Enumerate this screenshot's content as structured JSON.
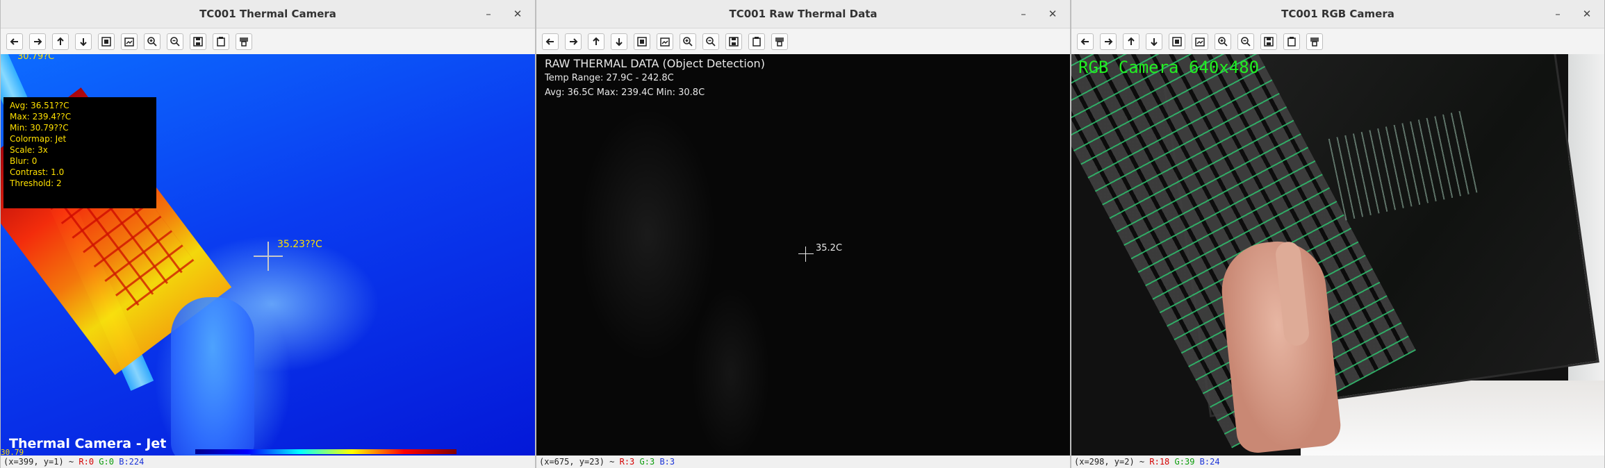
{
  "windows": [
    {
      "title": "TC001 Thermal Camera",
      "status": {
        "coords": "(x=399, y=1) ~ ",
        "r": "R:0",
        "g": "G:0",
        "b": "B:224"
      }
    },
    {
      "title": "TC001 Raw Thermal Data",
      "status": {
        "coords": "(x=675, y=23) ~ ",
        "r": "R:3",
        "g": "G:3",
        "b": "B:3"
      }
    },
    {
      "title": "TC001 RGB Camera",
      "status": {
        "coords": "(x=298, y=2) ~ ",
        "r": "R:18",
        "g": "G:39",
        "b": "B:24"
      }
    }
  ],
  "window_controls": {
    "minimize": "–",
    "close": "✕"
  },
  "toolbar_icons": [
    "arrow-left-icon",
    "arrow-right-icon",
    "arrow-up-icon",
    "arrow-down-icon",
    "image-icon",
    "image-settings-icon",
    "zoom-in-icon",
    "zoom-out-icon",
    "save-icon",
    "copy-icon",
    "properties-icon"
  ],
  "thermal": {
    "top_truncated": "30.79?C",
    "stats": [
      "Avg: 36.51??C",
      "Max: 239.4??C",
      "Min: 30.79??C",
      "Colormap: Jet",
      "Scale: 3x",
      "Blur: 0",
      "Contrast: 1.0",
      "Threshold: 2"
    ],
    "crosshair_value": "35.23??C",
    "label": "Thermal Camera - Jet",
    "colorbar_tick": "30.79"
  },
  "raw": {
    "title": "RAW THERMAL DATA (Object Detection)",
    "range": "Temp Range: 27.9C - 242.8C",
    "stats": "Avg: 36.5C  Max: 239.4C  Min: 30.8C",
    "crosshair_value": "35.2C"
  },
  "rgb": {
    "label": "RGB Camera 640x480"
  },
  "colors": {
    "overlay_yellow": "#ffe100",
    "rgb_label_green": "#22ee22",
    "status_r": "#d40000",
    "status_g": "#0a9c0a",
    "status_b": "#1a32d8"
  }
}
